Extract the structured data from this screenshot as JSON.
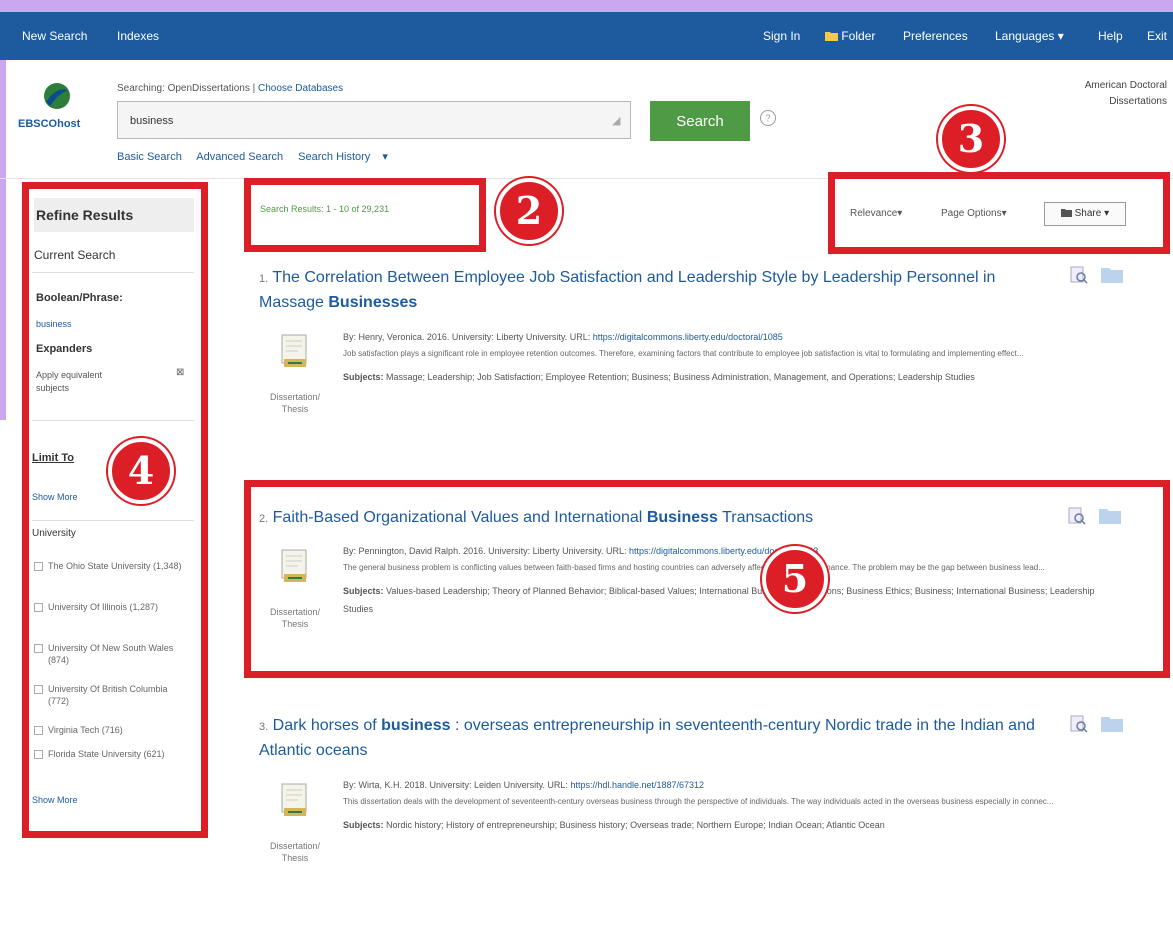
{
  "navbar": {
    "left": [
      "New Search",
      "Indexes"
    ],
    "right": [
      "Sign In",
      "Folder",
      "Preferences",
      "Languages",
      "Help",
      "Exit"
    ]
  },
  "brand": {
    "logo_text": "EBSCOhost"
  },
  "search": {
    "searching_label": "Searching: OpenDissertations",
    "choose_db": "Choose Databases",
    "query": "business",
    "button_label": "Search",
    "help_glyph": "?",
    "links": [
      "Basic Search",
      "Advanced Search",
      "Search History"
    ]
  },
  "database_name": [
    "American Doctoral",
    "Dissertations"
  ],
  "sidebar": {
    "title": "Refine Results",
    "current_search": "Current Search",
    "boolean_label": "Boolean/Phrase:",
    "boolean_value": "business",
    "expanders_label": "Expanders",
    "expander_item": "Apply equivalent subjects",
    "limit_to": "Limit To",
    "show_more": "Show More",
    "university_label": "University",
    "universities": [
      "The Ohio State University (1,348)",
      "University Of Illinois (1,287)",
      "University Of New South Wales (874)",
      "University Of British Columbia (772)",
      "Virginia Tech (716)",
      "Florida State University (621)"
    ],
    "show_more_2": "Show More"
  },
  "results_header": {
    "count_text": "Search Results: 1 - 10 of 29,231",
    "sort": "Relevance",
    "page_options": "Page Options",
    "share": "Share"
  },
  "results": [
    {
      "num": "1.",
      "title_pre": "The Correlation Between Employee Job Satisfaction and Leadership Style by Leadership Personnel in Massage",
      "title_bold": "Businesses",
      "title_post": "",
      "byline": "By: Henry, Veronica. 2016. University: Liberty University. URL:",
      "url": "https://digitalcommons.liberty.edu/doctoral/1085",
      "abstract": "Job satisfaction plays a significant role in employee retention outcomes. Therefore, examining factors that contribute to employee job satisfaction is vital to formulating and implementing effect...",
      "subjects_label": "Subjects:",
      "subjects": "Massage; Leadership; Job Satisfaction; Employee Retention; Business; Business Administration, Management, and Operations; Leadership Studies",
      "doctype": "Dissertation/ Thesis"
    },
    {
      "num": "2.",
      "title_pre": "Faith-Based Organizational Values and International",
      "title_bold": "Business",
      "title_post": "Transactions",
      "byline": "By: Pennington, David Ralph. 2016. University: Liberty University. URL:",
      "url": "https://digitalcommons.liberty.edu/doctoral/1163",
      "abstract": "The general business problem is conflicting values between faith-based firms and hosting countries can adversely affect business performance. The problem may be the gap between business lead...",
      "subjects_label": "Subjects:",
      "subjects": "Values-based Leadership; Theory of Planned Behavior; Biblical-based Values; International Business Transactions; Business Ethics; Business; International Business; Leadership Studies",
      "doctype": "Dissertation/ Thesis"
    },
    {
      "num": "3.",
      "title_pre": "Dark horses of",
      "title_bold": "business",
      "title_post": ": overseas entrepreneurship in seventeenth-century Nordic trade in the Indian and Atlantic oceans",
      "byline": "By: Wirta, K.H. 2018. University: Leiden University. URL:",
      "url": "https://hdl.handle.net/1887/67312",
      "abstract": "This dissertation deals with the development of seventeenth-century overseas business through the perspective of individuals. The way individuals acted in the overseas business especially in connec...",
      "subjects_label": "Subjects:",
      "subjects": "Nordic history; History of entrepreneurship; Business history; Overseas trade; Northern Europe; Indian Ocean; Atlantic Ocean",
      "doctype": "Dissertation/ Thesis"
    }
  ],
  "annotations": [
    "2",
    "3",
    "4",
    "5"
  ],
  "icons": {
    "logo": "ebsco-logo-icon",
    "folder_nav": "folder-icon",
    "preview": "magnifier-preview-icon",
    "folder": "add-to-folder-icon",
    "doc": "dissertation-icon"
  },
  "colors": {
    "nav": "#1d5a9e",
    "search_button": "#4f9a44",
    "highlight": "#dc1e26",
    "frame": "#c9a8ef"
  }
}
